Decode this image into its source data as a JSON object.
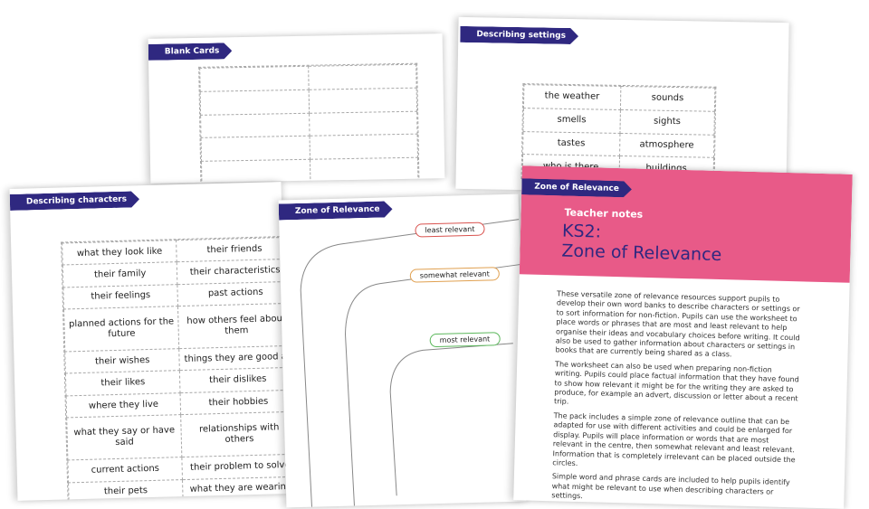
{
  "sheets": {
    "blank_cards": {
      "title": "Blank Cards",
      "rows": 5,
      "cols": 2
    },
    "describing_settings": {
      "title": "Describing settings",
      "cards": [
        [
          "the weather",
          "sounds"
        ],
        [
          "smells",
          "sights"
        ],
        [
          "tastes",
          "atmosphere"
        ],
        [
          "who is there",
          "buildings"
        ]
      ]
    },
    "describing_characters": {
      "title": "Describing characters",
      "cards": [
        [
          "what they look like",
          "their friends"
        ],
        [
          "their family",
          "their characteristics"
        ],
        [
          "their feelings",
          "past actions"
        ],
        [
          "planned actions for the future",
          "how others feel about them"
        ],
        [
          "their wishes",
          "things they are good at"
        ],
        [
          "their likes",
          "their dislikes"
        ],
        [
          "where they live",
          "their hobbies"
        ],
        [
          "what they say or have said",
          "relationships with others"
        ],
        [
          "current actions",
          "their problem to solve"
        ],
        [
          "their pets",
          "what they are wearing"
        ]
      ]
    },
    "zone_worksheet": {
      "title": "Zone of Relevance",
      "zones": [
        {
          "label": "least relevant",
          "color": "#d9534f"
        },
        {
          "label": "somewhat relevant",
          "color": "#e0a050"
        },
        {
          "label": "most relevant",
          "color": "#5cb85c"
        }
      ]
    },
    "teacher_notes": {
      "banner": "Zone of Relevance",
      "subtitle": "Teacher notes",
      "key_stage": "KS2:",
      "title": "Zone of Relevance",
      "paragraphs": [
        "These versatile zone of relevance resources support pupils to develop their own word banks to describe characters or settings or to sort information for non-fiction. Pupils can use the worksheet to place words or phrases that are most and least relevant to help organise their ideas and vocabulary choices before writing. It could also be used to gather information about characters or settings in books that are currently being shared as a class.",
        "The worksheet can also be used when preparing non-fiction writing. Pupils could place factual information that they have found to show how relevant it might be for the writing they are asked to produce, for example an advert, discussion or letter about a recent trip.",
        "The pack includes a simple zone of relevance outline that can be adapted for use with different activities and could be enlarged for display. Pupils will place information or words that are most relevant in the centre, then somewhat relevant and least relevant. Information that is completely irrelevant can be placed outside the circles.",
        "Simple word and phrase cards are included to help pupils identify what might be relevant to use when describing characters or settings."
      ]
    }
  },
  "colors": {
    "banner": "#2f2880",
    "pink": "#e85a88",
    "title_text": "#2f2880"
  }
}
